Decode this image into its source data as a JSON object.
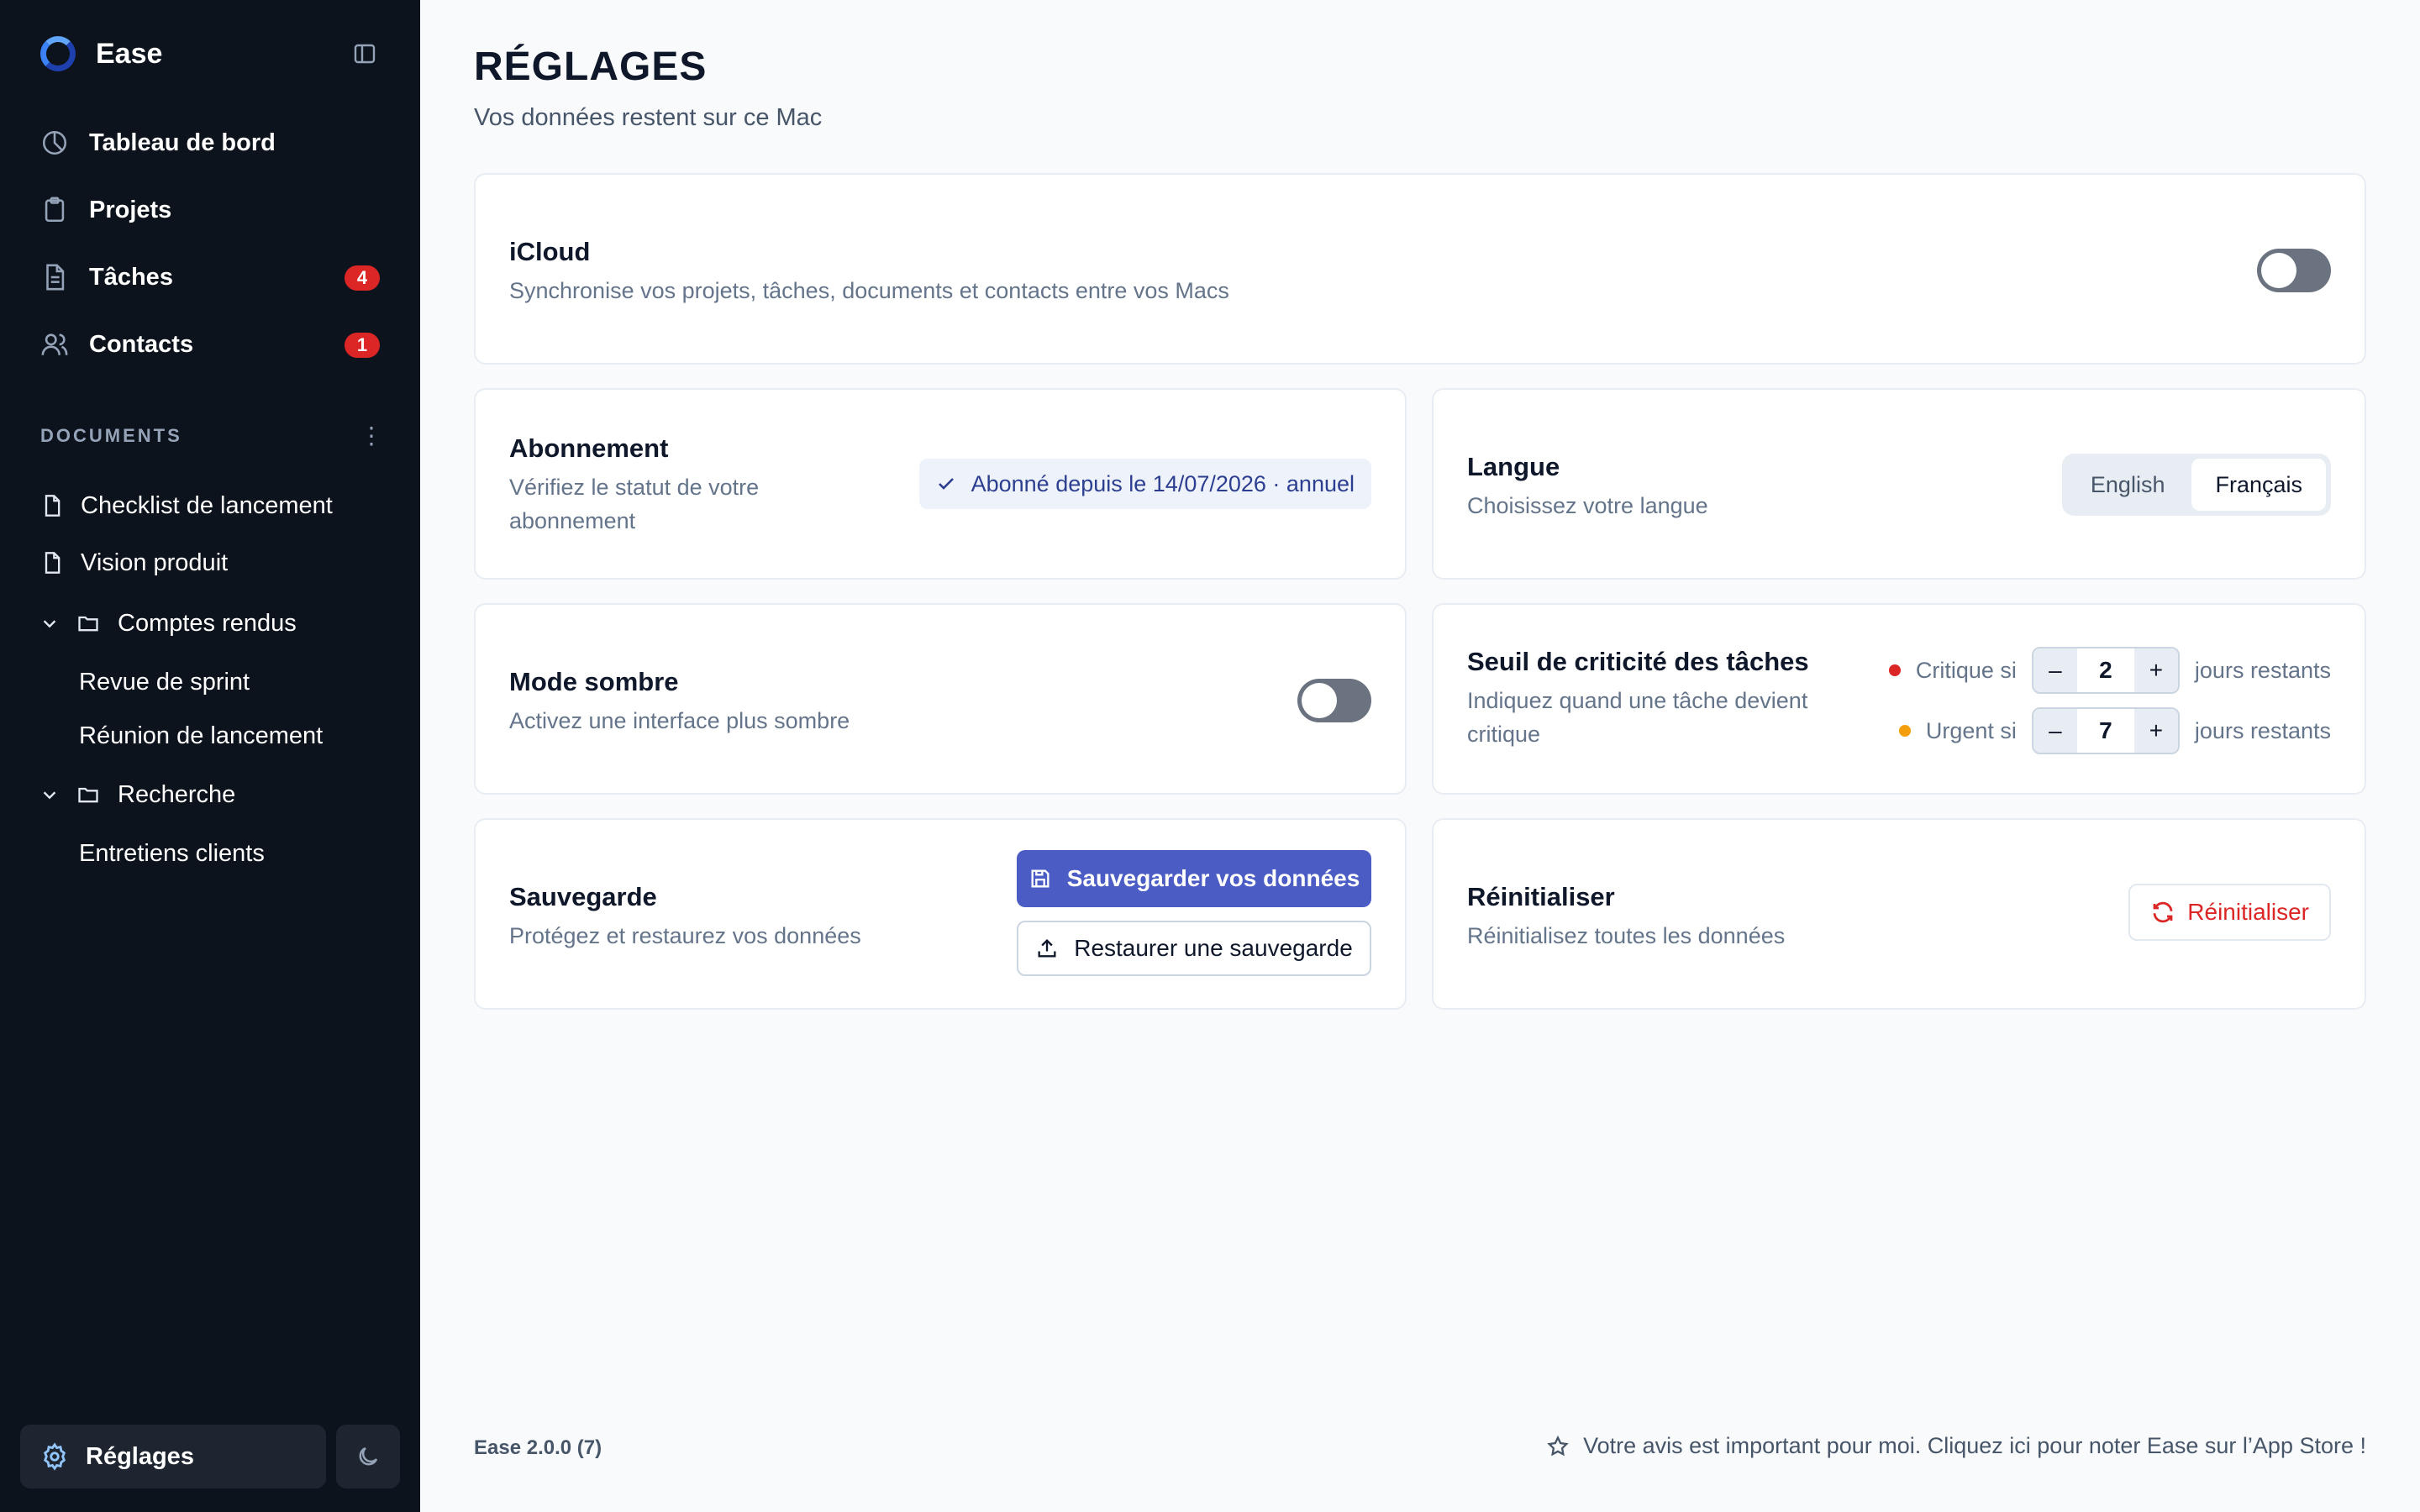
{
  "app": {
    "name": "Ease"
  },
  "sidebar": {
    "nav": [
      {
        "label": "Tableau de bord",
        "icon": "dashboard-icon"
      },
      {
        "label": "Projets",
        "icon": "clipboard-icon"
      },
      {
        "label": "Tâches",
        "icon": "document-icon",
        "badge": "4"
      },
      {
        "label": "Contacts",
        "icon": "users-icon",
        "badge": "1"
      }
    ],
    "documents_title": "DOCUMENTS",
    "documents": {
      "doc1": "Checklist de lancement",
      "doc2": "Vision produit",
      "folder1": "Comptes rendus",
      "folder1_children": [
        "Revue de sprint",
        "Réunion de lancement"
      ],
      "folder2": "Recherche",
      "folder2_children": [
        "Entretiens clients"
      ]
    },
    "settings_label": "Réglages"
  },
  "page": {
    "title": "RÉGLAGES",
    "subtitle": "Vos données restent sur ce Mac"
  },
  "icloud": {
    "title": "iCloud",
    "desc": "Synchronise vos projets, tâches, documents et contacts entre vos Macs",
    "enabled": false
  },
  "subscription": {
    "title": "Abonnement",
    "desc": "Vérifiez le statut de votre abonnement",
    "status": "Abonné depuis le 14/07/2026 · annuel"
  },
  "language": {
    "title": "Langue",
    "desc": "Choisissez votre langue",
    "options": [
      "English",
      "Français"
    ],
    "selected": "Français"
  },
  "dark_mode": {
    "title": "Mode sombre",
    "desc": "Activez une interface plus sombre",
    "enabled": false
  },
  "threshold": {
    "title": "Seuil de criticité des tâches",
    "desc": "Indiquez quand une tâche devient critique",
    "critical_label": "Critique si",
    "critical_value": "2",
    "urgent_label": "Urgent si",
    "urgent_value": "7",
    "unit": "jours restants",
    "minus": "–",
    "plus": "+",
    "critical_color": "#dc2626",
    "urgent_color": "#f59e0b"
  },
  "backup": {
    "title": "Sauvegarde",
    "desc": "Protégez et restaurez vos données",
    "save_label": "Sauvegarder vos données",
    "restore_label": "Restaurer une sauvegarde"
  },
  "reset": {
    "title": "Réinitialiser",
    "desc": "Réinitialisez toutes les données",
    "button_label": "Réinitialiser"
  },
  "footer": {
    "version": "Ease 2.0.0 (7)",
    "feedback": "Votre avis est important pour moi. Cliquez ici pour noter Ease sur l’App Store !"
  },
  "colors": {
    "sidebar_bg": "#0d131d",
    "accent": "#4b5cc4",
    "danger": "#dc2626"
  }
}
